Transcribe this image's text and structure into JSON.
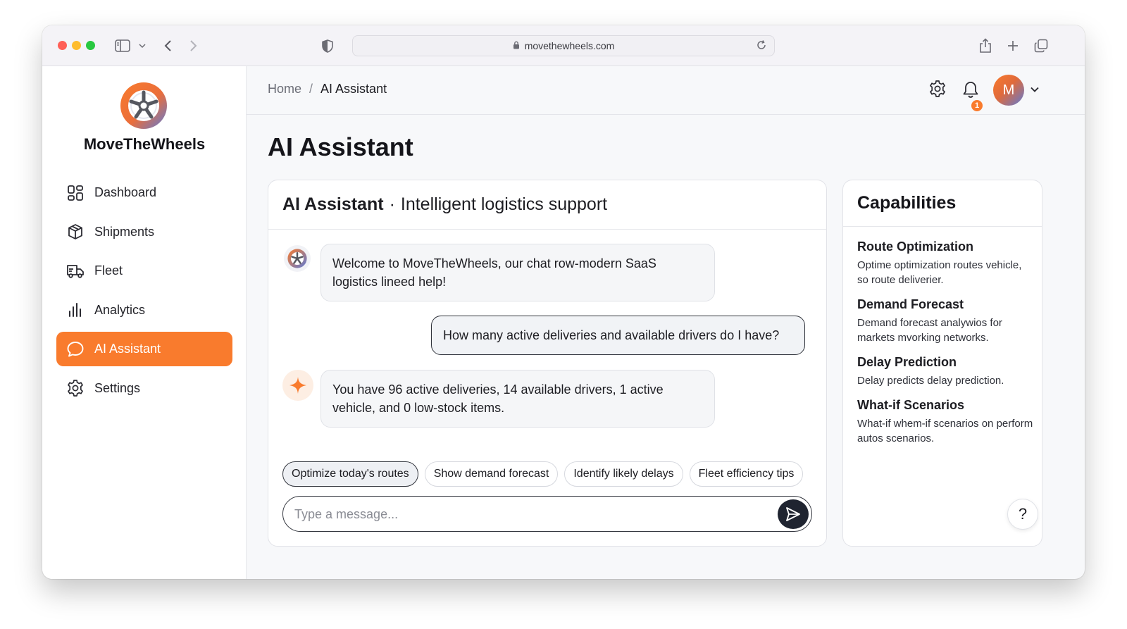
{
  "browser": {
    "url": "movethewheels.com"
  },
  "brand": {
    "name": "MoveTheWheels"
  },
  "sidebar": {
    "items": [
      {
        "label": "Dashboard",
        "icon": "dashboard-grid-icon",
        "active": false
      },
      {
        "label": "Shipments",
        "icon": "box-icon",
        "active": false
      },
      {
        "label": "Fleet",
        "icon": "truck-icon",
        "active": false
      },
      {
        "label": "Analytics",
        "icon": "bar-chart-icon",
        "active": false
      },
      {
        "label": "AI Assistant",
        "icon": "chat-bubble-icon",
        "active": true
      },
      {
        "label": "Settings",
        "icon": "gear-icon",
        "active": false
      }
    ]
  },
  "header": {
    "breadcrumb": {
      "home": "Home",
      "separator": "/",
      "current": "AI Assistant"
    },
    "notifications_count": "1",
    "avatar_initial": "M"
  },
  "page": {
    "title": "AI Assistant"
  },
  "chat": {
    "title_strong": "AI Assistant",
    "title_sep": "·",
    "title_rest": "Intelligent logistics support",
    "messages": [
      {
        "role": "assistant",
        "text": "Welcome to MoveTheWheels, our chat row-modern SaaS logistics lineed help!"
      },
      {
        "role": "user",
        "text": "How many active deliveries and available drivers do I have?"
      },
      {
        "role": "assistant",
        "text": "You have 96 active deliveries, 14 available drivers, 1 active vehicle, and 0 low-stock items."
      }
    ],
    "suggestions": [
      "Optimize today's routes",
      "Show demand forecast",
      "Identify likely delays",
      "Fleet efficiency tips"
    ],
    "input": {
      "placeholder": "Type a message...",
      "value": ""
    }
  },
  "capabilities": {
    "title": "Capabilities",
    "items": [
      {
        "title": "Route Optimization",
        "desc": "Optime optimization routes vehicle, so route deliverier."
      },
      {
        "title": "Demand Forecast",
        "desc": "Demand forecast analywios for markets mvorking networks."
      },
      {
        "title": "Delay Prediction",
        "desc": "Delay predicts delay prediction."
      },
      {
        "title": "What-if Scenarios",
        "desc": "What-if whem-if scenarios on perform autos scenarios."
      }
    ]
  },
  "help": {
    "label": "?"
  },
  "colors": {
    "accent": "#f97b2d",
    "dark": "#1f2430",
    "logo_blue": "#5d7bd6"
  }
}
